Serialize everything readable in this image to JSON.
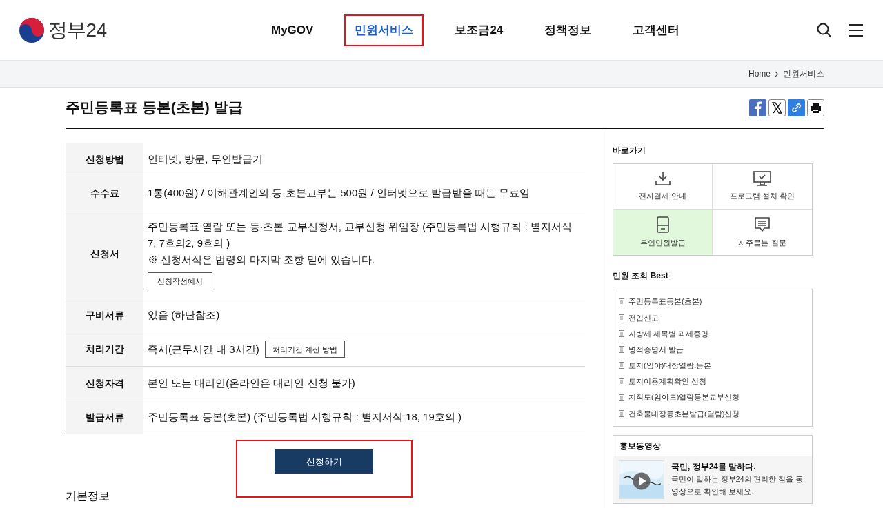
{
  "header": {
    "logo_text": "정부24",
    "nav": [
      {
        "label": "MyGOV",
        "selected": false,
        "highlighted": false
      },
      {
        "label": "민원서비스",
        "selected": true,
        "highlighted": true
      },
      {
        "label": "보조금24",
        "selected": false,
        "highlighted": false
      },
      {
        "label": "정책정보",
        "selected": false,
        "highlighted": false
      },
      {
        "label": "고객센터",
        "selected": false,
        "highlighted": false
      }
    ]
  },
  "breadcrumb": [
    "Home",
    "민원서비스"
  ],
  "page_title": "주민등록표 등본(초본) 발급",
  "info_rows": [
    {
      "kind": "text",
      "label": "신청방법",
      "value": "인터넷, 방문, 무인발급기"
    },
    {
      "kind": "text",
      "label": "수수료",
      "value": "1통(400원) / 이해관계인의 등·초본교부는 500원 / 인터넷으로 발급받을 때는 무료임"
    },
    {
      "kind": "stacked",
      "label": "신청서",
      "value": "주민등록표 열람 또는 등·초본 교부신청서, 교부신청 위임장 (주민등록법 시행규칙 : 별지서식 7, 7호의2, 9호의 )",
      "note": "※ 신청서식은 법령의 마지막 조항 밑에 있습니다.",
      "button": "신청작성예시"
    },
    {
      "kind": "text",
      "label": "구비서류",
      "value": "있음 (하단참조)"
    },
    {
      "kind": "inline",
      "label": "처리기간",
      "value": "즉시(근무시간 내 3시간)",
      "button": "처리기간 계산 방법"
    },
    {
      "kind": "text",
      "label": "신청자격",
      "value": "본인 또는 대리인(온라인은 대리인 신청 불가)"
    },
    {
      "kind": "text",
      "label": "발급서류",
      "value": "주민등록표 등본(초본) (주민등록법 시행규칙 : 별지서식 18, 19호의 )"
    }
  ],
  "apply_button": {
    "label": "신청하기",
    "highlighted": true
  },
  "section_title": "기본정보",
  "sidebar": {
    "shortcuts_title": "바로가기",
    "shortcuts": [
      {
        "kind": "download",
        "label": "전자결제 안내",
        "selected": false
      },
      {
        "kind": "monitor",
        "label": "프로그램 설치 확인",
        "selected": false
      },
      {
        "kind": "kiosk",
        "label": "무인민원발급",
        "selected": true
      },
      {
        "kind": "chat",
        "label": "자주묻는 질문",
        "selected": false
      }
    ],
    "best_title": "민원 조회 Best",
    "best_items": [
      "주민등록표등본(초본)",
      "전입신고",
      "지방세 세목별 과세증명",
      "병적증명서 발급",
      "토지(임야)대장열람.등본",
      "토지이용계획확인 신청",
      "지적도(임야도)열람등본교부신청",
      "건축물대장등초본발급(열람)신청"
    ],
    "video_title": "홍보동영상",
    "video_headline": "국민, 정부24를 말하다.",
    "video_text": "국민이 말하는 정부24의 편리한 점을 동영상으로 확인해 보세요."
  }
}
